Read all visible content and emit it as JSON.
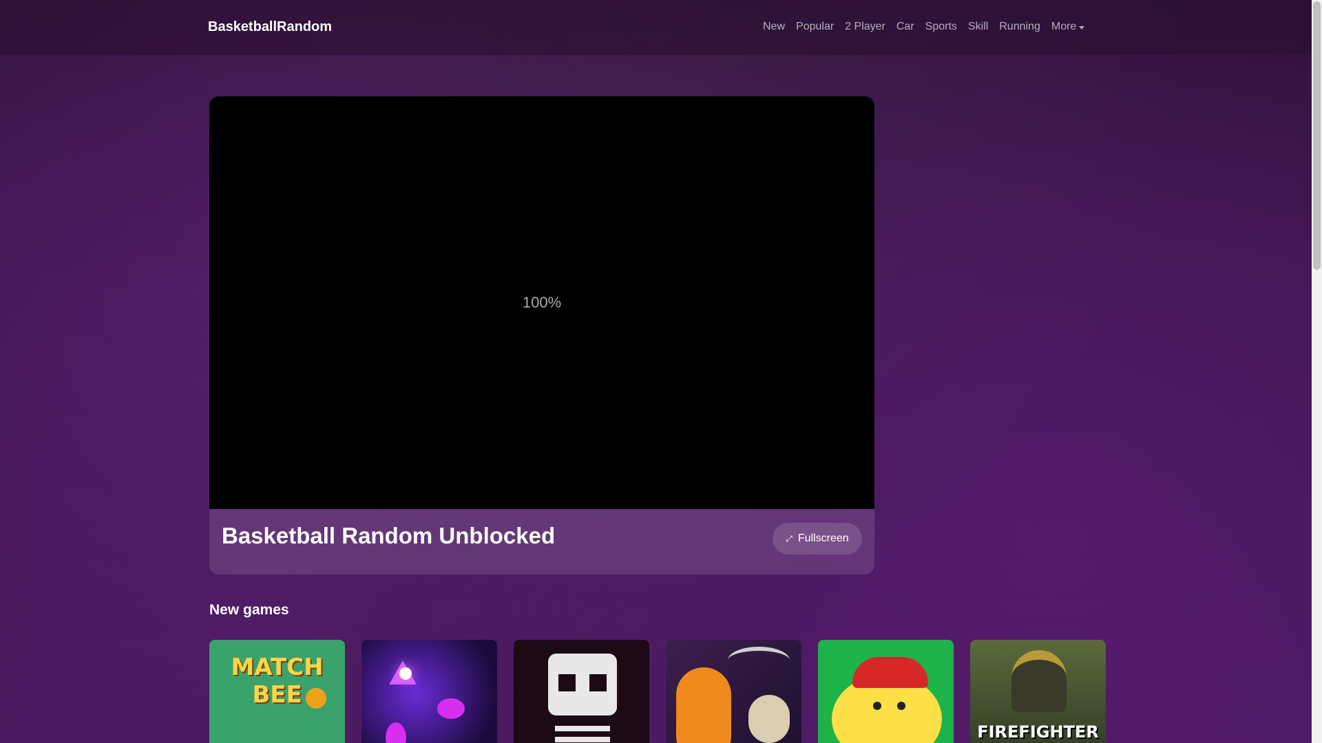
{
  "header": {
    "brand": "BasketballRandom",
    "nav": [
      {
        "label": "New"
      },
      {
        "label": "Popular"
      },
      {
        "label": "2 Player"
      },
      {
        "label": "Car"
      },
      {
        "label": "Sports"
      },
      {
        "label": "Skill"
      },
      {
        "label": "Running"
      },
      {
        "label": "More"
      }
    ]
  },
  "game": {
    "loading_text": "100%",
    "title": "Basketball Random Unblocked",
    "fullscreen_label": "Fullscreen",
    "fullscreen_icon": "expand-icon"
  },
  "new_games": {
    "title": "New games",
    "items": [
      {
        "name": "match-bee",
        "label_line1": "MATCH",
        "label_line2": "BEE"
      },
      {
        "name": "neon-game"
      },
      {
        "name": "skeleton-game"
      },
      {
        "name": "reaper-game"
      },
      {
        "name": "golf-game"
      },
      {
        "name": "firefighter-pinball",
        "label": "FIREFIGHTER"
      }
    ]
  }
}
